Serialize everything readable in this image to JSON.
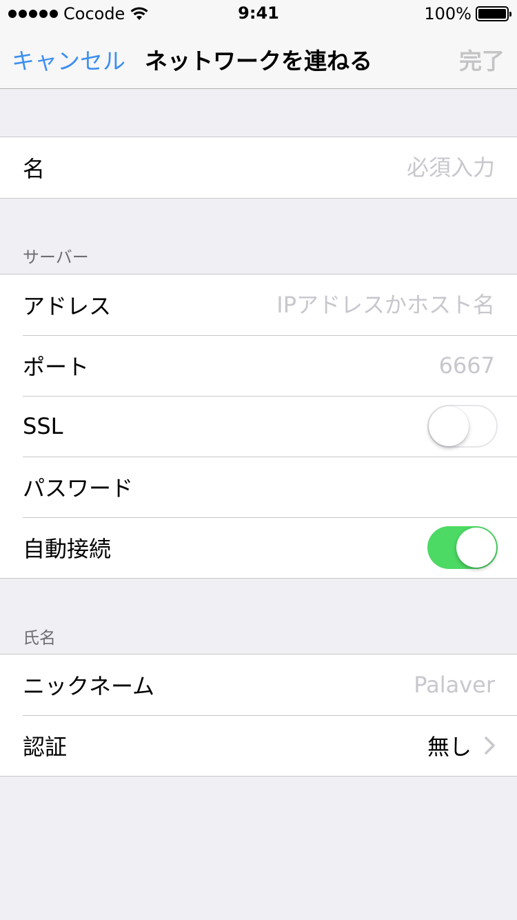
{
  "status_bar": {
    "carrier": "Cocode",
    "time": "9:41",
    "battery": "100%",
    "signal_bars": 5
  },
  "nav": {
    "cancel_label": "キャンセル",
    "title": "ネットワークを連ねる",
    "done_label": "完了"
  },
  "name_section": {
    "label": "名",
    "placeholder": "必須入力"
  },
  "server_section": {
    "header": "サーバー",
    "address_label": "アドレス",
    "address_placeholder": "IPアドレスかホスト名",
    "port_label": "ポート",
    "port_placeholder": "6667",
    "ssl_label": "SSL",
    "ssl_on": false,
    "password_label": "パスワード",
    "autoconnect_label": "自動接続",
    "autoconnect_on": true
  },
  "identity_section": {
    "header": "氏名",
    "nickname_label": "ニックネーム",
    "nickname_placeholder": "Palaver",
    "auth_label": "認証",
    "auth_value": "無し"
  },
  "colors": {
    "accent": "#3d8ff0",
    "toggle_on": "#4cd964",
    "placeholder": "#c7c7cd",
    "background": "#efeff4"
  },
  "icons": {
    "wifi": "wifi-icon",
    "battery": "battery-icon",
    "chevron": "chevron-right-icon"
  }
}
